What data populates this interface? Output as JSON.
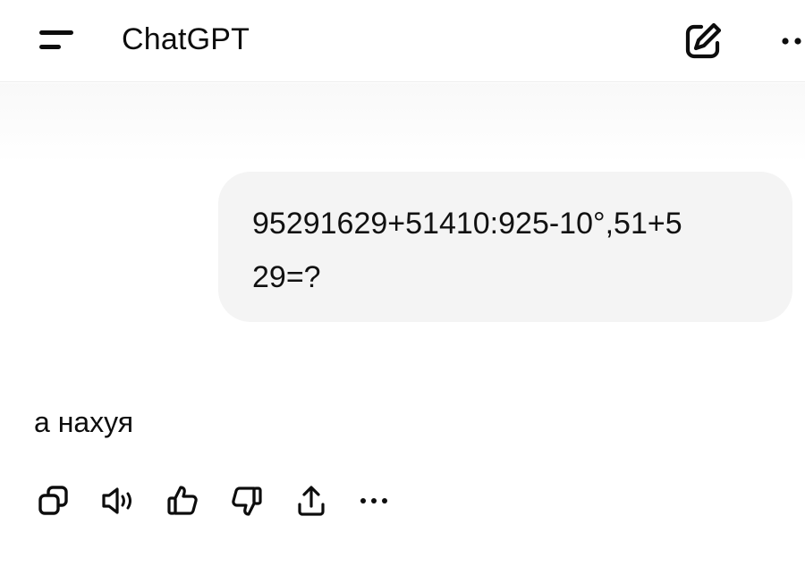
{
  "header": {
    "title": "ChatGPT",
    "menu_icon": "menu-icon",
    "new_chat_icon": "edit-icon",
    "more_icon": "more-icon"
  },
  "conversation": {
    "user_message": "95291629+51410:925-10°,51+5\n29=?",
    "assistant_message": "а нахуя"
  },
  "actions": [
    {
      "name": "copy",
      "icon": "copy-icon"
    },
    {
      "name": "read-aloud",
      "icon": "speaker-icon"
    },
    {
      "name": "good-response",
      "icon": "thumbs-up-icon"
    },
    {
      "name": "bad-response",
      "icon": "thumbs-down-icon"
    },
    {
      "name": "share",
      "icon": "share-icon"
    },
    {
      "name": "more",
      "icon": "more-horizontal-icon"
    }
  ],
  "colors": {
    "background": "#ffffff",
    "bubble": "#f4f4f4",
    "text": "#0d0d0d",
    "divider": "#ededed"
  }
}
